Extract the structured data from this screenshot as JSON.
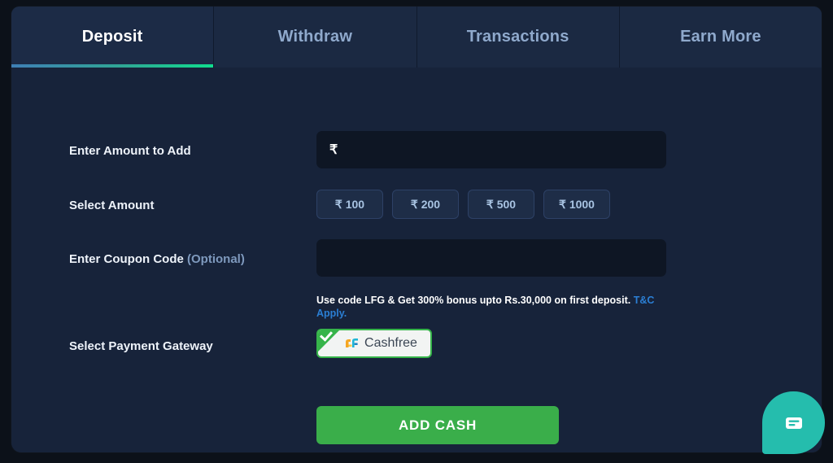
{
  "window": {
    "background": "#0c1119",
    "panel_background": "#17233a"
  },
  "tabs": {
    "active_index": 0,
    "items": [
      {
        "label": "Deposit",
        "active": true
      },
      {
        "label": "Withdraw",
        "active": false
      },
      {
        "label": "Transactions",
        "active": false
      },
      {
        "label": "Earn More",
        "active": false
      }
    ],
    "active_underline_color": "#10dd8e",
    "inactive_label_color": "#8fa9cc",
    "active_label_color": "#ffffff"
  },
  "deposit_form": {
    "amount": {
      "label": "Enter Amount to Add",
      "currency_symbol": "₹",
      "value": "",
      "placeholder": ""
    },
    "select_amount": {
      "label": "Select Amount",
      "options": [
        "₹ 100",
        "₹ 200",
        "₹ 500",
        "₹ 1000"
      ],
      "chip_text_color": "#a8c3e2"
    },
    "coupon": {
      "label": "Enter Coupon Code ",
      "label_optional": "(Optional)",
      "value": "",
      "placeholder": ""
    },
    "promo": {
      "prefix": "Use code ",
      "code": "LFG",
      "middle": " & Get 300% bonus upto Rs.30,000 on first deposit. ",
      "link": "T&C Apply.",
      "link_color": "#2b7fd4"
    },
    "gateway": {
      "label": "Select Payment Gateway",
      "options": [
        {
          "name": "Cashfree",
          "selected": true,
          "border_color": "#36b44a"
        }
      ]
    },
    "submit": {
      "label": "ADD CASH",
      "color": "#3aae4a"
    }
  },
  "chat_widget": {
    "icon": "chat-bubble-icon",
    "color": "#25bdad"
  }
}
